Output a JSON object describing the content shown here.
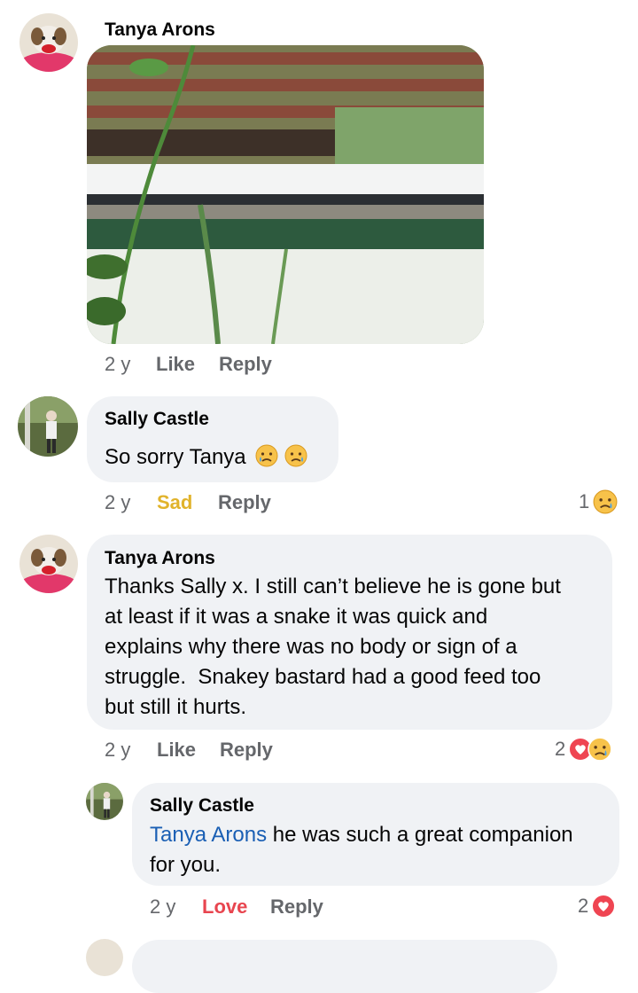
{
  "comments": [
    {
      "author": "Tanya Arons",
      "media": "photo",
      "time": "2 y",
      "action1": "Like",
      "action2": "Reply"
    },
    {
      "author": "Sally Castle",
      "text": "So sorry Tanya",
      "time": "2 y",
      "action1": "Sad",
      "action2": "Reply",
      "reaction_count": "1",
      "reaction_icons": [
        "crying-face-icon"
      ]
    },
    {
      "author": "Tanya Arons",
      "lines": [
        "Thanks Sally x. I still can’t believe he is gone but",
        "at least if it was a snake it was quick and",
        "explains why there was no body or sign of a",
        "struggle.  Snakey bastard had a good feed too",
        "but still it hurts."
      ],
      "time": "2 y",
      "action1": "Like",
      "action2": "Reply",
      "reaction_count": "2",
      "reaction_icons": [
        "love-heart-icon",
        "crying-face-icon"
      ]
    },
    {
      "author": "Sally Castle",
      "mention": "Tanya Arons",
      "line1_rest": " he was such a great companion",
      "line2": "for you.",
      "time": "2 y",
      "action1": "Love",
      "action2": "Reply",
      "reaction_count": "2",
      "reaction_icons": [
        "love-heart-icon"
      ]
    }
  ],
  "colors": {
    "bubble": "#f0f2f5",
    "meta": "#65676b",
    "sad": "#e1b32b",
    "love": "#e8454f",
    "mention": "#1a5fb4"
  }
}
